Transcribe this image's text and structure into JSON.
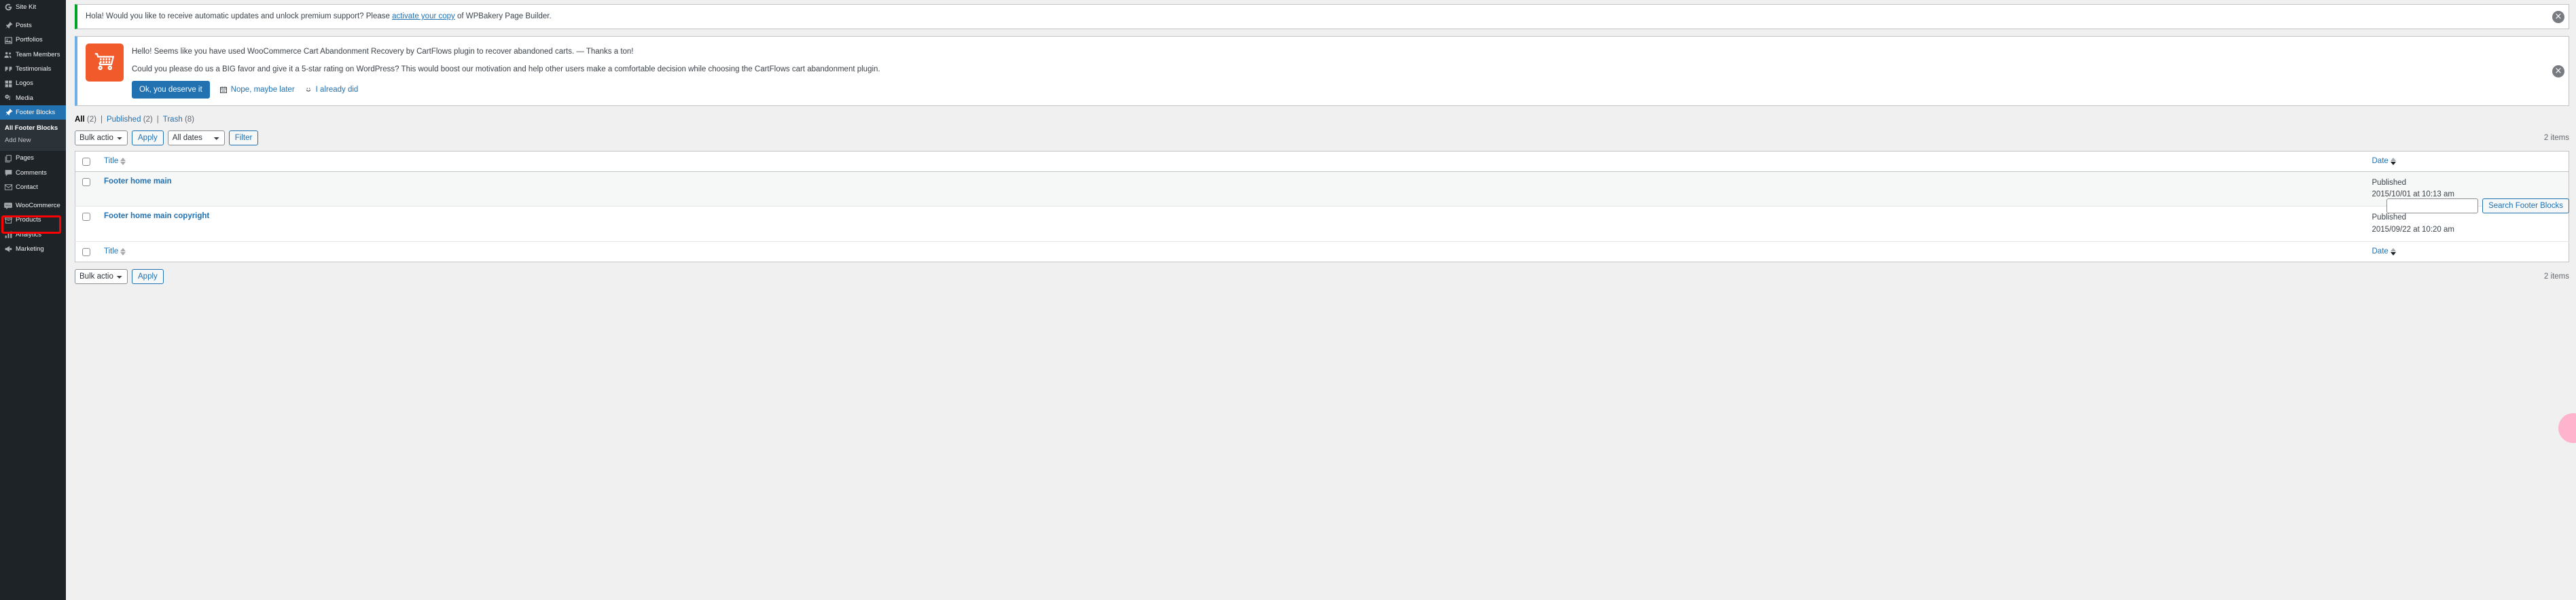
{
  "sidebar": {
    "items": [
      {
        "label": "Site Kit",
        "icon": "google-site-kit-icon",
        "name": "sidebar-item-site-kit",
        "gap_after": true
      },
      {
        "label": "Posts",
        "icon": "pin-icon",
        "name": "sidebar-item-posts"
      },
      {
        "label": "Portfolios",
        "icon": "image-icon",
        "name": "sidebar-item-portfolios"
      },
      {
        "label": "Team Members",
        "icon": "users-icon",
        "name": "sidebar-item-team-members"
      },
      {
        "label": "Testimonials",
        "icon": "quote-icon",
        "name": "sidebar-item-testimonials"
      },
      {
        "label": "Logos",
        "icon": "grid-icon",
        "name": "sidebar-item-logos"
      },
      {
        "label": "Media",
        "icon": "media-icon",
        "name": "sidebar-item-media"
      },
      {
        "label": "Footer Blocks",
        "icon": "pin-icon",
        "name": "sidebar-item-footer-blocks",
        "current": true
      },
      {
        "label": "Pages",
        "icon": "pages-icon",
        "name": "sidebar-item-pages",
        "gap_before": true
      },
      {
        "label": "Comments",
        "icon": "comment-icon",
        "name": "sidebar-item-comments"
      },
      {
        "label": "Contact",
        "icon": "envelope-icon",
        "name": "sidebar-item-contact"
      },
      {
        "label": "WooCommerce",
        "icon": "woo-icon",
        "name": "sidebar-item-woocommerce",
        "gap_before": true
      },
      {
        "label": "Products",
        "icon": "product-box-icon",
        "name": "sidebar-item-products"
      },
      {
        "label": "Analytics",
        "icon": "bar-chart-icon",
        "name": "sidebar-item-analytics"
      },
      {
        "label": "Marketing",
        "icon": "megaphone-icon",
        "name": "sidebar-item-marketing"
      }
    ],
    "submenu": [
      {
        "label": "All Footer Blocks",
        "current": true
      },
      {
        "label": "Add New",
        "current": false
      }
    ]
  },
  "notices": {
    "wpbakery": {
      "text_before": "Hola! Would you like to receive automatic updates and unlock premium support? Please ",
      "link": "activate your copy",
      "text_after": " of WPBakery Page Builder.",
      "accent": "#00a32a",
      "dismiss": "×"
    },
    "cartflows": {
      "icon": "shopping-cart-icon",
      "icon_color": "#f15a2b",
      "line1": "Hello! Seems like you have used WooCommerce Cart Abandonment Recovery by CartFlows plugin to recover abandoned carts. — Thanks a ton!",
      "line2": "Could you please do us a BIG favor and give it a 5-star rating on WordPress? This would boost our motivation and help other users make a comfortable decision while choosing the CartFlows cart abandonment plugin.",
      "primary_button": "Ok, you deserve it",
      "later_link": "Nope, maybe later",
      "later_icon": "calendar-icon",
      "already_link": "I already did",
      "already_icon": "smiley-icon",
      "accent": "#72aee6",
      "dismiss": "×"
    }
  },
  "filters": {
    "all": {
      "label": "All",
      "count": "(2)"
    },
    "published": {
      "label": "Published",
      "count": "(2)"
    },
    "trash": {
      "label": "Trash",
      "count": "(8)"
    },
    "separator": "|"
  },
  "search": {
    "value": "",
    "placeholder": "",
    "button_label": "Search Footer Blocks"
  },
  "tablenav_top": {
    "bulk_select": "Bulk actions",
    "apply_label": "Apply",
    "dates_select": "All dates",
    "filter_label": "Filter",
    "displaying_num": "2 items"
  },
  "tablenav_bottom": {
    "bulk_select": "Bulk actions",
    "apply_label": "Apply",
    "displaying_num": "2 items"
  },
  "table": {
    "columns": {
      "title": "Title",
      "date": "Date"
    },
    "rows": [
      {
        "title": "Footer home main",
        "status": "Published",
        "date": "2015/10/01 at 10:13 am"
      },
      {
        "title": "Footer home main copyright",
        "status": "Published",
        "date": "2015/09/22 at 10:20 am"
      }
    ]
  },
  "colors": {
    "admin_bg": "#1d2327",
    "current_menu": "#2271b1",
    "link": "#2271b1",
    "highlight_outline": "#ff0000",
    "cart_orange": "#f15a2b",
    "notice_green": "#00a32a",
    "notice_blue": "#72aee6",
    "pink_bubble": "#ffb3cd"
  }
}
